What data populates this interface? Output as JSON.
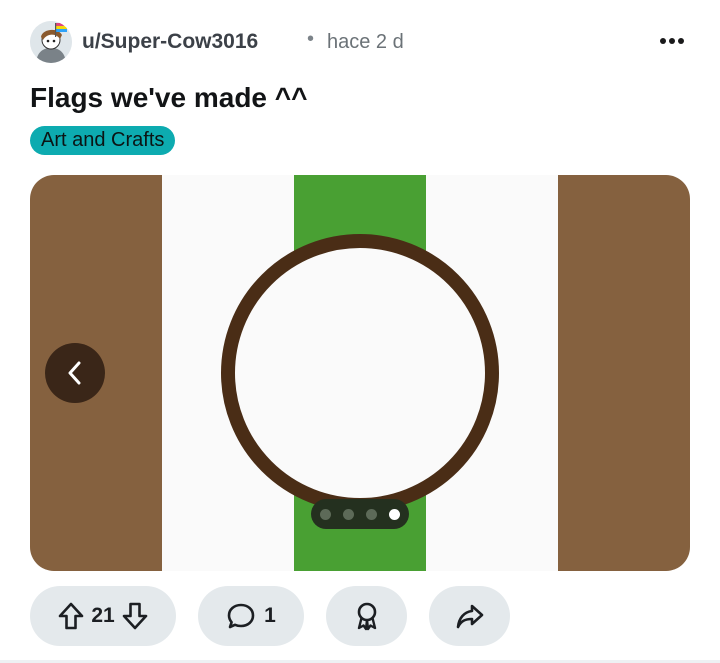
{
  "post": {
    "username": "u/Super-Cow3016",
    "separator": "•",
    "time": "hace 2 d",
    "title": "Flags we've made ^^",
    "flair": "Art and Crafts"
  },
  "carousel": {
    "page_count": 4,
    "current_page": 4
  },
  "actions": {
    "vote_count": "21",
    "comment_count": "1"
  },
  "icons": {
    "more": "more-options-icon",
    "prev": "chevron-left-icon",
    "upvote": "upvote-arrow-icon",
    "downvote": "downvote-arrow-icon",
    "comment": "comment-bubble-icon",
    "award": "award-ribbon-icon",
    "share": "share-arrow-icon"
  },
  "colors": {
    "flair_bg": "#0dabb0",
    "flag_brown": "#85613f",
    "flag_white": "#fafafa",
    "flag_green": "#49a033",
    "ring": "#4a2d16",
    "pill_bg": "#e4e9ec"
  }
}
